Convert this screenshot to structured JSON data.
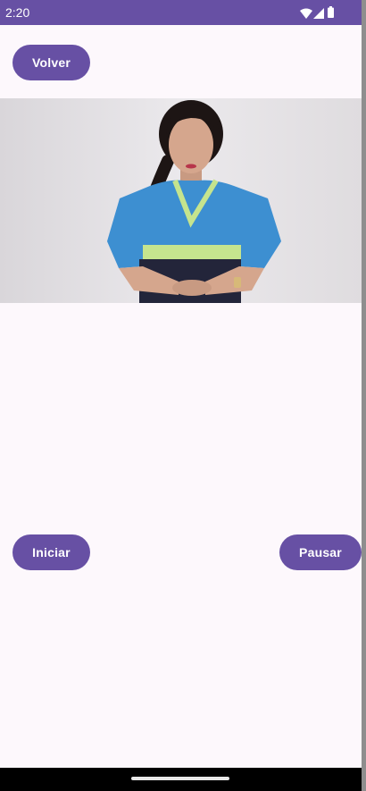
{
  "status_bar": {
    "time": "2:20",
    "icons": [
      "wifi-icon",
      "signal-icon",
      "battery-icon"
    ],
    "color": "#6750a4"
  },
  "buttons": {
    "back": "Volver",
    "start": "Iniciar",
    "pause": "Pausar"
  },
  "video": {
    "description_icon": "video-player"
  },
  "colors": {
    "accent": "#6750a4",
    "background": "#fdf8fc"
  }
}
